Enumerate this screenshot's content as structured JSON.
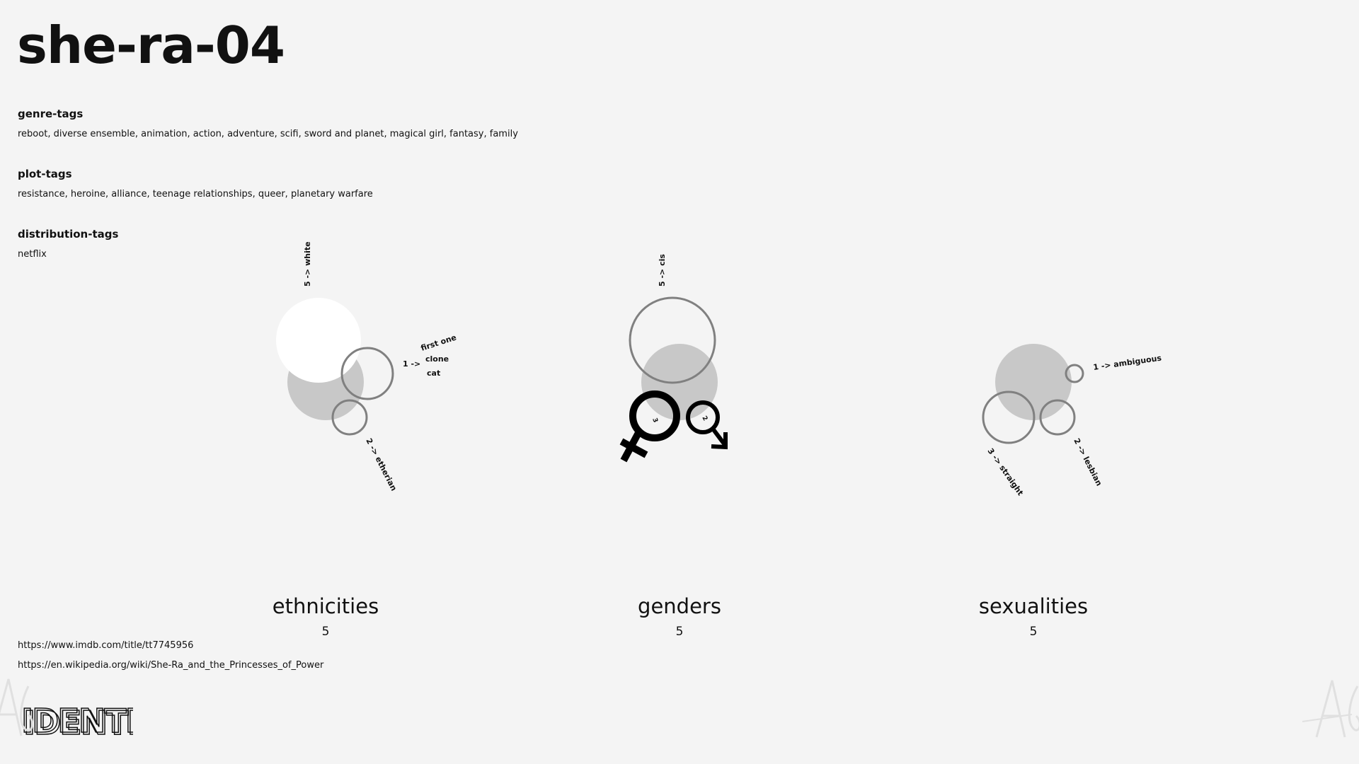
{
  "title": "she-ra-04",
  "meta": {
    "genre_label": "genre-tags",
    "genre_value": "reboot, diverse ensemble, animation, action, adventure, scifi, sword and planet, magical girl, fantasy, family",
    "plot_label": "plot-tags",
    "plot_value": "resistance, heroine, alliance, teenage relationships, queer, planetary warfare",
    "dist_label": "distribution-tags",
    "dist_value": "netflix"
  },
  "links": {
    "imdb": "https://www.imdb.com/title/tt7745956",
    "wiki": "https://en.wikipedia.org/wiki/She-Ra_and_the_Princesses_of_Power"
  },
  "ethnicities": {
    "label": "ethnicities",
    "count": "5",
    "white": "5 -> white",
    "other_count": "1 ->",
    "first_one": "first one",
    "clone": "clone",
    "cat": "cat",
    "etherian": "2 -> etherian"
  },
  "genders": {
    "label": "genders",
    "count": "5",
    "cis": "5 -> cis",
    "female_count": "3",
    "male_count": "2"
  },
  "sexualities": {
    "label": "sexualities",
    "count": "5",
    "ambiguous": "1 -> ambiguous",
    "straight": "3 -> straight",
    "lesbian": "2 -> lesbian"
  },
  "logo_text": "IDENTI",
  "colors": {
    "background": "#f4f4f4",
    "fill_gray": "#c8c8c8",
    "stroke_gray": "#808080",
    "white": "#ffffff"
  }
}
